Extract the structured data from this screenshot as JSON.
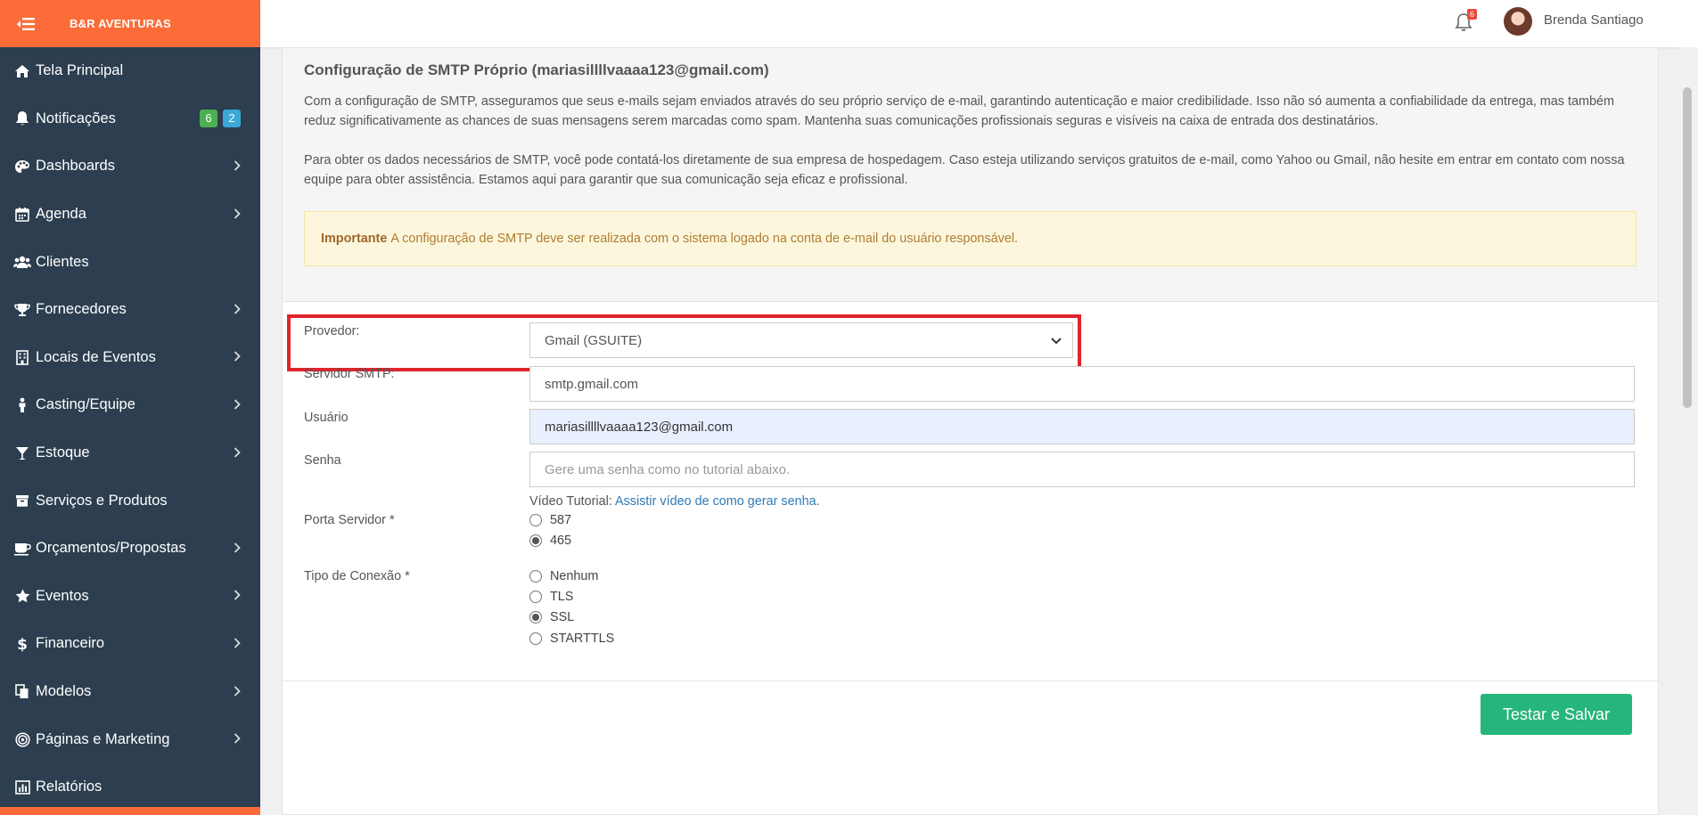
{
  "sidebar": {
    "brand": "B&R AVENTURAS",
    "items": [
      {
        "label": "Tela Principal",
        "icon": "home-icon",
        "chevron": false
      },
      {
        "label": "Notificações",
        "icon": "bell-icon",
        "chevron": false,
        "badges": [
          "6",
          "2"
        ]
      },
      {
        "label": "Dashboards",
        "icon": "palette-icon",
        "chevron": true
      },
      {
        "label": "Agenda",
        "icon": "calendar-icon",
        "chevron": true
      },
      {
        "label": "Clientes",
        "icon": "users-icon",
        "chevron": false
      },
      {
        "label": "Fornecedores",
        "icon": "trophy-icon",
        "chevron": true
      },
      {
        "label": "Locais de Eventos",
        "icon": "building-icon",
        "chevron": true
      },
      {
        "label": "Casting/Equipe",
        "icon": "person-icon",
        "chevron": true
      },
      {
        "label": "Estoque",
        "icon": "glass-icon",
        "chevron": true
      },
      {
        "label": "Serviços e Produtos",
        "icon": "box-icon",
        "chevron": false
      },
      {
        "label": "Orçamentos/Propostas",
        "icon": "coffee-icon",
        "chevron": true
      },
      {
        "label": "Eventos",
        "icon": "star-icon",
        "chevron": true
      },
      {
        "label": "Financeiro",
        "icon": "dollar-icon",
        "chevron": true
      },
      {
        "label": "Modelos",
        "icon": "copy-icon",
        "chevron": true
      },
      {
        "label": "Páginas e Marketing",
        "icon": "target-icon",
        "chevron": true
      },
      {
        "label": "Relatórios",
        "icon": "chart-icon",
        "chevron": false
      }
    ]
  },
  "topbar": {
    "notification_count": "6",
    "user_name": "Brenda Santiago"
  },
  "intro": {
    "title": "Configuração de SMTP Próprio (mariasillllvaaaa123@gmail.com)",
    "paragraph1": "Com a configuração de SMTP, asseguramos que seus e-mails sejam enviados através do seu próprio serviço de e-mail, garantindo autenticação e maior credibilidade. Isso não só aumenta a confiabilidade da entrega, mas também reduz significativamente as chances de suas mensagens serem marcadas como spam. Mantenha suas comunicações profissionais seguras e visíveis na caixa de entrada dos destinatários.",
    "paragraph2": "Para obter os dados necessários de SMTP, você pode contatá-los diretamente de sua empresa de hospedagem. Caso esteja utilizando serviços gratuitos de e-mail, como Yahoo ou Gmail, não hesite em entrar em contato com nossa equipe para obter assistência. Estamos aqui para garantir que sua comunicação seja eficaz e profissional.",
    "alert_strong": "Importante",
    "alert_text": "A configuração de SMTP deve ser realizada com o sistema logado na conta de e-mail do usuário responsável."
  },
  "form": {
    "provider_label": "Provedor:",
    "provider_value": "Gmail (GSUITE)",
    "smtp_label": "Servidor SMTP:",
    "smtp_value": "smtp.gmail.com",
    "user_label": "Usuário",
    "user_value": "mariasillllvaaaa123@gmail.com",
    "password_label": "Senha",
    "password_placeholder": "Gere uma senha como no tutorial abaixo.",
    "tutorial_prefix": "Vídeo Tutorial:",
    "tutorial_link": "Assistir vídeo de como gerar senha.",
    "port_label": "Porta Servidor *",
    "port_options": [
      "587",
      "465"
    ],
    "port_selected": "465",
    "connection_label": "Tipo de Conexão *",
    "connection_options": [
      "Nenhum",
      "TLS",
      "SSL",
      "STARTTLS"
    ],
    "connection_selected": "SSL",
    "submit_label": "Testar e Salvar"
  },
  "colors": {
    "brand_orange": "#fb6c38",
    "sidebar_bg": "#2c3e4f",
    "highlight_red": "#e0242b",
    "button_green": "#26b67b"
  }
}
